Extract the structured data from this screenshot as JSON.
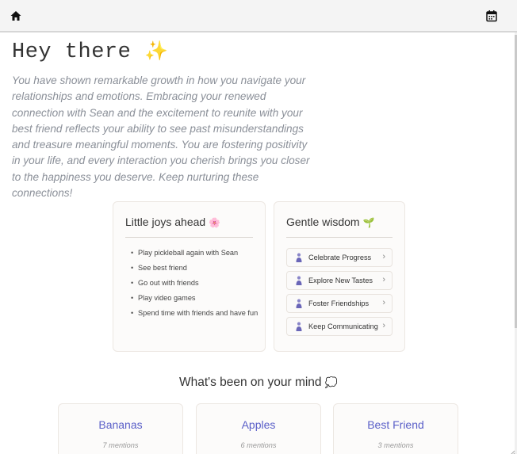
{
  "topbar": {
    "home_icon": "home-icon",
    "calendar_icon": "calendar-icon"
  },
  "greeting": {
    "text": "Hey there",
    "emoji": "✨"
  },
  "message": "You have shown remarkable growth in how you navigate your relationships and emotions. Embracing your renewed connection with Sean and the excitement to reunite with your best friend reflects your ability to see past misunderstandings and treasure meaningful moments. You are fostering positivity in your life, and every interaction you cherish brings you closer to the happiness you deserve. Keep nurturing these connections!",
  "joys": {
    "title": "Little joys ahead",
    "emoji": "🌸",
    "items": [
      "Play pickleball again with Sean",
      "See best friend",
      "Go out with friends",
      "Play video games",
      "Spend time with friends and have fun"
    ]
  },
  "wisdom": {
    "title": "Gentle wisdom",
    "emoji": "🌱",
    "items": [
      "Celebrate Progress",
      "Explore New Tastes",
      "Foster Friendships",
      "Keep Communicating"
    ]
  },
  "mind": {
    "title": "What's been on your mind",
    "emoji": "💭",
    "topics": [
      {
        "name": "Bananas",
        "count": "7 mentions"
      },
      {
        "name": "Apples",
        "count": "6 mentions"
      },
      {
        "name": "Best Friend",
        "count": "3 mentions"
      }
    ]
  },
  "colors": {
    "accent": "#5a5fc8",
    "muted_text": "#8a8f98",
    "card_bg": "#fcfbfa"
  }
}
